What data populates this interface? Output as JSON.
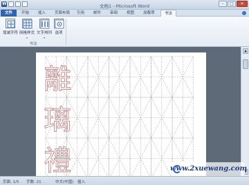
{
  "window": {
    "title": "文档1 - Microsoft Word"
  },
  "quick_access": [
    "word-logo",
    "save-icon",
    "undo-icon",
    "redo-icon"
  ],
  "tabs": [
    {
      "label": "文件"
    },
    {
      "label": "开始"
    },
    {
      "label": "插入"
    },
    {
      "label": "页面布局"
    },
    {
      "label": "引用"
    },
    {
      "label": "邮件"
    },
    {
      "label": "审阅"
    },
    {
      "label": "视图"
    },
    {
      "label": "加载项"
    },
    {
      "label": "书法"
    }
  ],
  "ribbon": {
    "group_label": "书法",
    "buttons": [
      {
        "label": "增减字符"
      },
      {
        "label": "网格样式"
      },
      {
        "label": "文字排列"
      },
      {
        "label": "选项"
      }
    ]
  },
  "document": {
    "characters": [
      "離",
      "璃",
      "禮"
    ],
    "grid_columns": 7,
    "grid_rows": 3,
    "grid_color": "#b0b0b0",
    "glyph_color": "#c98a8a"
  },
  "status": {
    "page": "页面: 1/5",
    "words": "字数: 21",
    "language": "中文(中国)",
    "mode": "插入"
  },
  "watermark": "www.2xuewang.com"
}
